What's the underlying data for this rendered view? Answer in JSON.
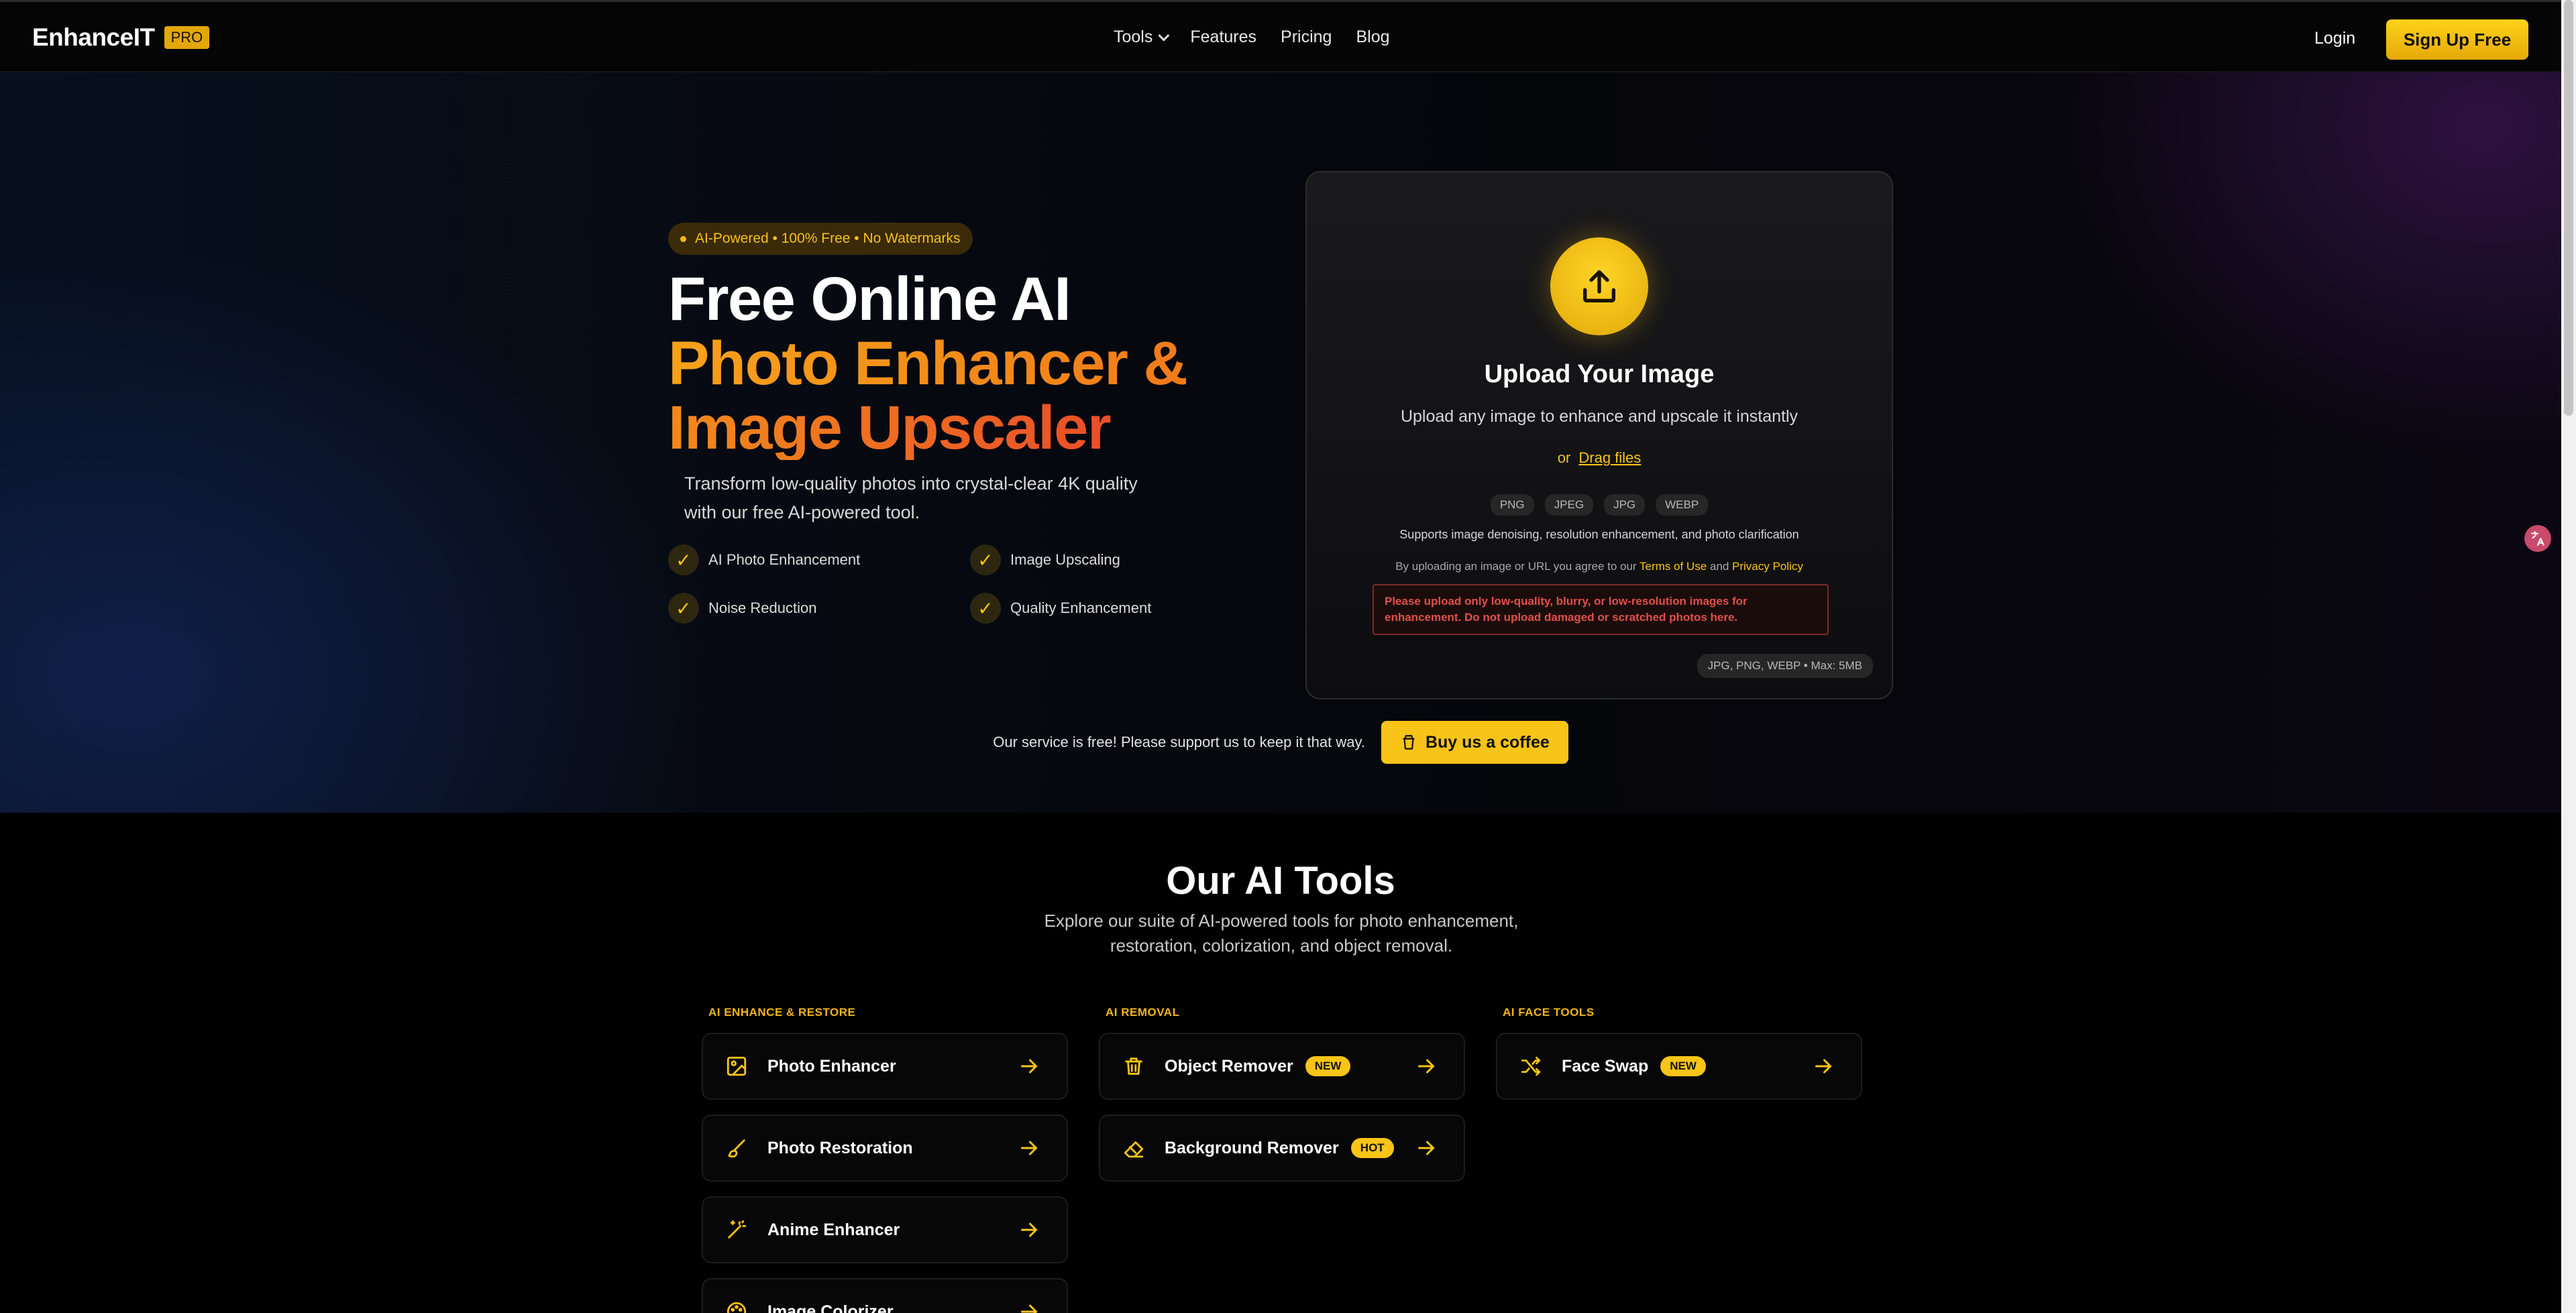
{
  "header": {
    "logo_text": "EnhanceIT",
    "logo_badge": "PRO",
    "nav": [
      {
        "label": "Tools"
      },
      {
        "label": "Features"
      },
      {
        "label": "Pricing"
      },
      {
        "label": "Blog"
      }
    ],
    "login": "Login",
    "signup": "Sign Up Free"
  },
  "hero": {
    "pill": "AI-Powered • 100% Free • No Watermarks",
    "title_line1": "Free Online AI",
    "title_line2": "Photo Enhancer &",
    "title_line3": "Image Upscaler",
    "subtitle": "Transform low-quality photos into crystal-clear 4K quality with our free AI-powered tool.",
    "features": [
      {
        "label": "AI Photo Enhancement"
      },
      {
        "label": "Image Upscaling"
      },
      {
        "label": "Noise Reduction"
      },
      {
        "label": "Quality Enhancement"
      }
    ]
  },
  "upload": {
    "title": "Upload Your Image",
    "subtitle": "Upload any image to enhance and upscale it instantly",
    "or": "or",
    "drag": "Drag files",
    "formats": [
      "PNG",
      "JPEG",
      "JPG",
      "WEBP"
    ],
    "supports": "Supports image denoising, resolution enhancement, and photo clarification",
    "terms_prefix": "By uploading an image or URL you agree to our",
    "terms_link": "Terms of Use",
    "terms_and": "and",
    "privacy_link": "Privacy Policy",
    "warning": "Please upload only low-quality, blurry, or low-resolution images for enhancement. Do not upload damaged or scratched photos here.",
    "max": "JPG, PNG, WEBP • Max: 5MB"
  },
  "support": {
    "text": "Our service is free! Please support us to keep it that way.",
    "button": "Buy us a coffee"
  },
  "tools": {
    "title": "Our AI Tools",
    "subtitle": "Explore our suite of AI-powered tools for photo enhancement, restoration, colorization, and object removal.",
    "columns": [
      {
        "label": "AI ENHANCE & RESTORE"
      },
      {
        "label": "AI REMOVAL"
      },
      {
        "label": "AI FACE TOOLS"
      }
    ],
    "items": [
      {
        "name": "Photo Enhancer",
        "icon": "image-icon"
      },
      {
        "name": "Photo Restoration",
        "icon": "brush-icon"
      },
      {
        "name": "Anime Enhancer",
        "icon": "magic-wand-icon"
      },
      {
        "name": "Image Colorizer",
        "icon": "palette-icon"
      },
      {
        "name": "Object Remover",
        "badge": "NEW",
        "icon": "trash-icon"
      },
      {
        "name": "Background Remover",
        "badge": "HOT",
        "icon": "eraser-icon"
      },
      {
        "name": "Face Swap",
        "badge": "NEW",
        "icon": "shuffle-icon"
      }
    ]
  },
  "colors": {
    "accent": "#f7c417",
    "background": "#000000",
    "warning": "#e0504a"
  }
}
